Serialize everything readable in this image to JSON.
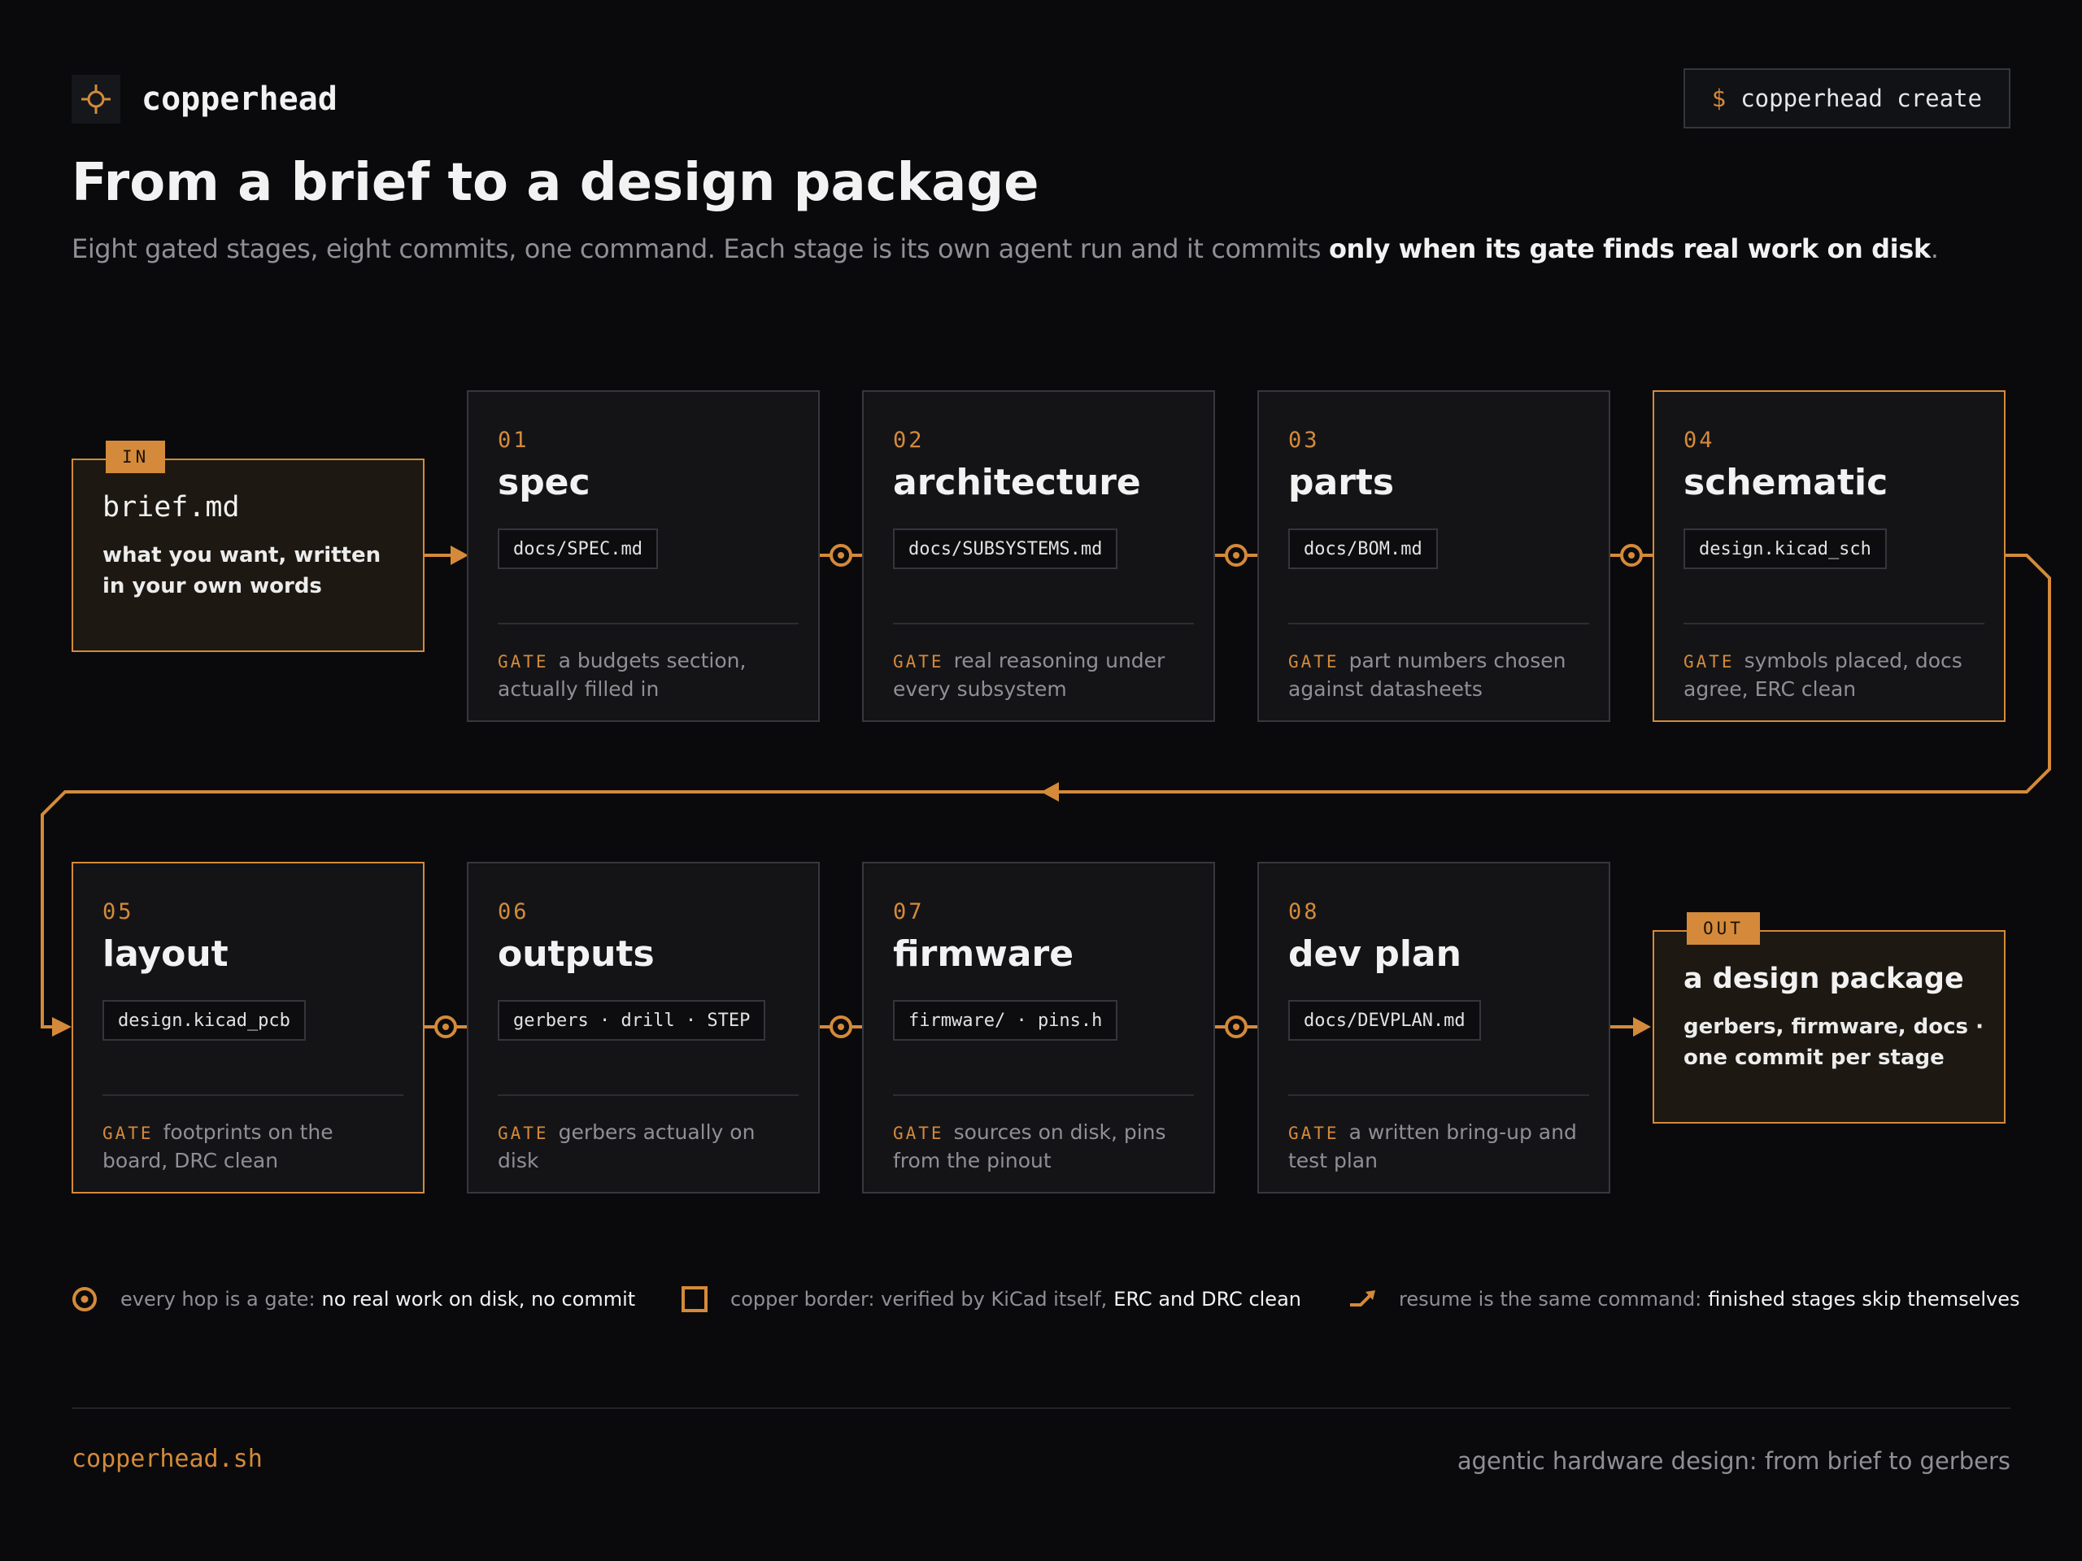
{
  "brand": {
    "name": "copperhead",
    "icon": "crosshair-icon"
  },
  "command": {
    "prompt": "$",
    "text": "copperhead create"
  },
  "title": "From a brief to a design package",
  "subtitle": {
    "lead": "Eight gated stages, eight commits, one command. Each stage is its own agent run and it commits ",
    "emphasis": "only when its gate finds real work on disk",
    "tail": "."
  },
  "input": {
    "tag": "IN",
    "title": "brief.md",
    "desc": "what you want, written in your own words"
  },
  "output": {
    "tag": "OUT",
    "title": "a design package",
    "desc": "gerbers, firmware, docs · one commit per stage"
  },
  "gate_label": "GATE",
  "stages": [
    {
      "num": "01",
      "name": "spec",
      "file": "docs/SPEC.md",
      "gate": "a budgets section, actually filled in",
      "copper": false
    },
    {
      "num": "02",
      "name": "architecture",
      "file": "docs/SUBSYSTEMS.md",
      "gate": "real reasoning under every subsystem",
      "copper": false
    },
    {
      "num": "03",
      "name": "parts",
      "file": "docs/BOM.md",
      "gate": "part numbers chosen against datasheets",
      "copper": false
    },
    {
      "num": "04",
      "name": "schematic",
      "file": "design.kicad_sch",
      "gate": "symbols placed, docs agree, ERC clean",
      "copper": true
    },
    {
      "num": "05",
      "name": "layout",
      "file": "design.kicad_pcb",
      "gate": "footprints on the board, DRC clean",
      "copper": true
    },
    {
      "num": "06",
      "name": "outputs",
      "file": "gerbers · drill · STEP",
      "gate": "gerbers actually on disk",
      "copper": false
    },
    {
      "num": "07",
      "name": "firmware",
      "file": "firmware/ · pins.h",
      "gate": "sources on disk, pins from the pinout",
      "copper": false
    },
    {
      "num": "08",
      "name": "dev plan",
      "file": "docs/DEVPLAN.md",
      "gate": "a written bring-up and test plan",
      "copper": false
    }
  ],
  "legend": [
    {
      "icon": "gate-node-icon",
      "text": "every hop is a gate:",
      "emphasis": "no real work on disk, no commit"
    },
    {
      "icon": "copper-border-icon",
      "text": "copper border: verified by KiCad itself,",
      "emphasis": "ERC and DRC clean"
    },
    {
      "icon": "resume-arrow-icon",
      "text": "resume is the same command:",
      "emphasis": "finished stages skip themselves"
    }
  ],
  "footer": {
    "url": "copperhead.sh",
    "tagline": "agentic hardware design: from brief to gerbers"
  },
  "colors": {
    "copper": "#d48a3a",
    "background": "#0a0a0c",
    "card": "#141417",
    "card_border": "#37383d",
    "io_fill": "#1d1812"
  }
}
